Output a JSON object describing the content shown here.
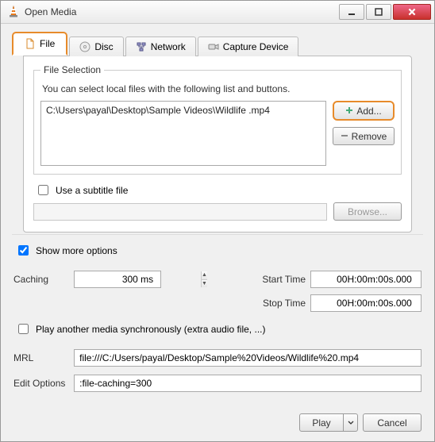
{
  "window": {
    "title": "Open Media"
  },
  "tabs": {
    "file": "File",
    "disc": "Disc",
    "network": "Network",
    "capture": "Capture Device"
  },
  "filesel": {
    "legend": "File Selection",
    "hint": "You can select local files with the following list and buttons.",
    "items": [
      "C:\\Users\\payal\\Desktop\\Sample Videos\\Wildlife .mp4"
    ],
    "add": "Add...",
    "remove": "Remove"
  },
  "subtitle": {
    "label": "Use a subtitle file",
    "browse": "Browse..."
  },
  "showmore": "Show more options",
  "options": {
    "caching_label": "Caching",
    "caching_value": "300 ms",
    "start_label": "Start Time",
    "start_value": "00H:00m:00s.000",
    "stop_label": "Stop Time",
    "stop_value": "00H:00m:00s.000"
  },
  "extra": {
    "label": "Play another media synchronously (extra audio file, ...)"
  },
  "mrl": {
    "label": "MRL",
    "value": "file:///C:/Users/payal/Desktop/Sample%20Videos/Wildlife%20.mp4"
  },
  "editopts": {
    "label": "Edit Options",
    "value": ":file-caching=300"
  },
  "footer": {
    "play": "Play",
    "cancel": "Cancel"
  }
}
